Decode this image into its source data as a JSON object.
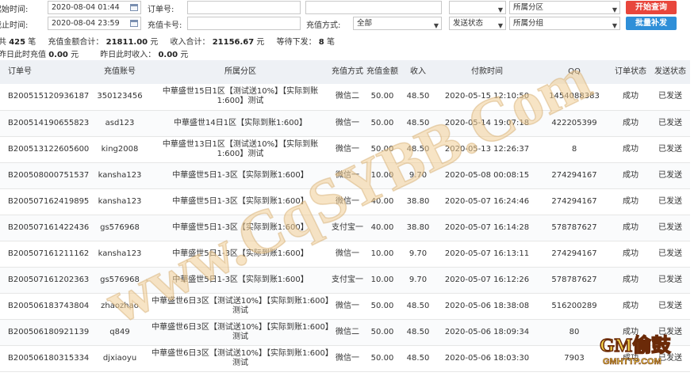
{
  "filters": {
    "row1": {
      "start_label": "起始时间:",
      "start_value": "2020-08-04 01:44",
      "order_label": "订单号:",
      "order_value": "",
      "account_label": "",
      "account_value": "",
      "status_select": "",
      "group_select": "所属分区",
      "query_button": "开始查询"
    },
    "row2": {
      "end_label": "截止时间:",
      "end_value": "2020-08-04 23:59",
      "card_label": "充值卡号:",
      "card_value": "",
      "method_label": "充值方式:",
      "method_value": "全部",
      "send_status_value": "发送状态",
      "group2_value": "所属分组",
      "reissue_button": "批量补发"
    }
  },
  "summary": {
    "total_label": "共",
    "total_count": "425",
    "total_unit": "笔",
    "amount_label": "充值金额合计：",
    "amount_value": "21811.00",
    "amount_unit": "元",
    "income_label": "收入合计：",
    "income_value": "21156.67",
    "income_unit": "元",
    "pending_label": "等待下发：",
    "pending_value": "8",
    "pending_unit": "笔",
    "yday_recharge_label": "昨日此时充值",
    "yday_recharge_value": "0.00",
    "yday_recharge_unit": "元",
    "yday_income_label": "昨日此时收入：",
    "yday_income_value": "0.00",
    "yday_income_unit": "元"
  },
  "table": {
    "headers": [
      "订单号",
      "充值账号",
      "所属分区",
      "充值方式",
      "充值金额",
      "收入",
      "付款时间",
      "QQ",
      "订单状态",
      "发送状态"
    ],
    "rows": [
      {
        "order": "B200515120936187",
        "account": "350123456",
        "zone": "中華盛世15日1区【测试送10%】【实际到账1:600】测试",
        "method": "微信二",
        "amount": "50.00",
        "income": "48.50",
        "time": "2020-05-15 12:10:50",
        "qq": "1454088383",
        "status": "成功",
        "send": "已发送"
      },
      {
        "order": "B200514190655823",
        "account": "asd123",
        "zone": "中華盛世14日1区【实际到账1:600】",
        "method": "微信一",
        "amount": "50.00",
        "income": "48.50",
        "time": "2020-05-14 19:07:18",
        "qq": "422205399",
        "status": "成功",
        "send": "已发送"
      },
      {
        "order": "B200513122605600",
        "account": "king2008",
        "zone": "中華盛世13日1区【测试送10%】【实际到账1:600】测试",
        "method": "微信一",
        "amount": "50.00",
        "income": "48.50",
        "time": "2020-05-13 12:26:37",
        "qq": "8",
        "status": "成功",
        "send": "已发送"
      },
      {
        "order": "B200508000751537",
        "account": "kansha123",
        "zone": "中華盛世5日1-3区【实际到账1:600】",
        "method": "微信一",
        "amount": "10.00",
        "income": "9.70",
        "time": "2020-05-08 00:08:15",
        "qq": "274294167",
        "status": "成功",
        "send": "已发送"
      },
      {
        "order": "B200507162419895",
        "account": "kansha123",
        "zone": "中華盛世5日1-3区【实际到账1:600】",
        "method": "微信一",
        "amount": "40.00",
        "income": "38.80",
        "time": "2020-05-07 16:24:46",
        "qq": "274294167",
        "status": "成功",
        "send": "已发送"
      },
      {
        "order": "B200507161422436",
        "account": "gs576968",
        "zone": "中華盛世5日1-3区【实际到账1:600】",
        "method": "支付宝一",
        "amount": "40.00",
        "income": "38.80",
        "time": "2020-05-07 16:14:28",
        "qq": "578787627",
        "status": "成功",
        "send": "已发送"
      },
      {
        "order": "B200507161211162",
        "account": "kansha123",
        "zone": "中華盛世5日1-3区【实际到账1:600】",
        "method": "微信一",
        "amount": "10.00",
        "income": "9.70",
        "time": "2020-05-07 16:13:11",
        "qq": "274294167",
        "status": "成功",
        "send": "已发送"
      },
      {
        "order": "B200507161202363",
        "account": "gs576968",
        "zone": "中華盛世5日1-3区【实际到账1:600】",
        "method": "支付宝一",
        "amount": "10.00",
        "income": "9.70",
        "time": "2020-05-07 16:12:26",
        "qq": "578787627",
        "status": "成功",
        "send": "已发送"
      },
      {
        "order": "B200506183743804",
        "account": "zhaozhao",
        "zone": "中華盛世6日3区【测试送10%】【实际到账1:600】测试",
        "method": "微信一",
        "amount": "50.00",
        "income": "48.50",
        "time": "2020-05-06 18:38:08",
        "qq": "516200289",
        "status": "成功",
        "send": "已发送"
      },
      {
        "order": "B200506180921139",
        "account": "q849",
        "zone": "中華盛世6日3区【测试送10%】【实际到账1:600】测试",
        "method": "微信二",
        "amount": "50.00",
        "income": "48.50",
        "time": "2020-05-06 18:09:34",
        "qq": "80",
        "status": "成功",
        "send": "已发送"
      },
      {
        "order": "B200506180315334",
        "account": "djxiaoyu",
        "zone": "中華盛世6日3区【测试送10%】【实际到账1:600】测试",
        "method": "微信一",
        "amount": "50.00",
        "income": "48.50",
        "time": "2020-05-06 18:03:30",
        "qq": "7903",
        "status": "成功",
        "send": "已发送"
      }
    ]
  },
  "watermark": {
    "text": "www.CqSYBB.Com",
    "logo_text": "GM偷鼓",
    "logo_sub": "GMHTTP.COM"
  },
  "colors": {
    "link_blue": "#1e7ad6",
    "button_red": "#e8463c",
    "button_blue": "#2f8fd8",
    "header_bg": "#eef1f5"
  },
  "icons": {
    "calendar": "calendar-icon",
    "dropdown": "chevron-down-icon"
  }
}
